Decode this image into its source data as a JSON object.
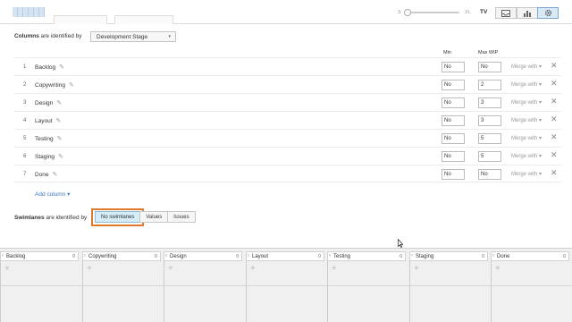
{
  "toolbar": {
    "zoom_min_label": "S",
    "zoom_max_label": "XL",
    "tv_label": "TV",
    "zoom_level": 0,
    "view_icons": [
      "inbox-icon",
      "bar-chart-icon",
      "gear-icon"
    ]
  },
  "columns_section": {
    "label_bold": "Columns",
    "label_rest": " are identified by",
    "selected_value": "Development Stage",
    "min_header": "Min",
    "max_header": "Max WIP",
    "rows": [
      {
        "num": "1",
        "name": "Backlog",
        "min": "No",
        "max": "No",
        "merge": "Merge with ▾",
        "remove": "✕"
      },
      {
        "num": "2",
        "name": "Copywriting",
        "min": "No",
        "max": "2",
        "merge": "Merge with ▾",
        "remove": "✕"
      },
      {
        "num": "3",
        "name": "Design",
        "min": "No",
        "max": "3",
        "merge": "Merge with ▾",
        "remove": "✕"
      },
      {
        "num": "4",
        "name": "Layout",
        "min": "No",
        "max": "3",
        "merge": "Merge with ▾",
        "remove": "✕"
      },
      {
        "num": "5",
        "name": "Testing",
        "min": "No",
        "max": "5",
        "merge": "Merge with ▾",
        "remove": "✕"
      },
      {
        "num": "6",
        "name": "Staging",
        "min": "No",
        "max": "5",
        "merge": "Merge with ▾",
        "remove": "✕"
      },
      {
        "num": "7",
        "name": "Done",
        "min": "No",
        "max": "No",
        "merge": "Merge with ▾",
        "remove": "✕"
      }
    ],
    "add_column_label": "Add column ▾"
  },
  "swimlanes_section": {
    "label_bold": "Swimlanes",
    "label_rest": " are identified by",
    "options": [
      "No swimlanes",
      "Values",
      "Issues"
    ],
    "selected": "No swimlanes"
  },
  "board": {
    "columns": [
      {
        "name": "Backlog",
        "count": "0"
      },
      {
        "name": "Copywriting",
        "count": "0"
      },
      {
        "name": "Design",
        "count": "0"
      },
      {
        "name": "Layout",
        "count": "0"
      },
      {
        "name": "Testing",
        "count": "0"
      },
      {
        "name": "Staging",
        "count": "0"
      },
      {
        "name": "Done",
        "count": "0"
      }
    ]
  },
  "colors": {
    "highlight": "#e0792b",
    "active_button": "#d6ecf7",
    "link": "#3a75c4"
  }
}
